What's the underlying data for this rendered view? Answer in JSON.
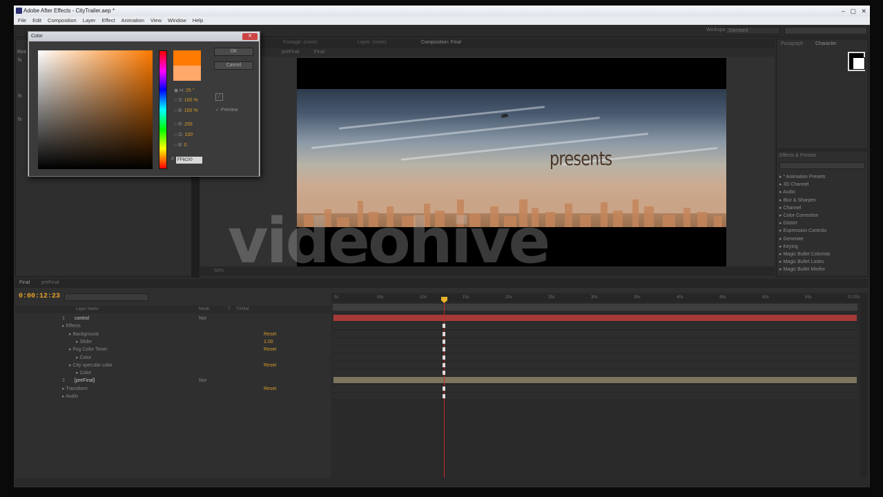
{
  "window": {
    "title": "Adobe After Effects - CityTrailer.aep *",
    "min": "–",
    "max": "▢",
    "close": "✕"
  },
  "menu": [
    "File",
    "Edit",
    "Composition",
    "Layer",
    "Effect",
    "Animation",
    "View",
    "Window",
    "Help"
  ],
  "toolbar": {
    "workspace_label": "Workspace:",
    "workspace_value": "Standard"
  },
  "left_panel": {
    "rows": [
      "fx",
      "fx",
      "fx"
    ],
    "label": "Rea"
  },
  "comp_panel": {
    "tabs": [
      "Footage: (none)",
      "Layer: (none)",
      "Composition: Final"
    ],
    "crumbs": [
      "preFinal",
      "Final"
    ],
    "overlay_text": "presents",
    "watermark": "videohive",
    "zoom": "50%"
  },
  "right_panel": {
    "tabs": [
      "Paragraph",
      "Character"
    ]
  },
  "effects_panel": {
    "title": "Effects & Presets",
    "items": [
      "* Animation Presets",
      "3D Channel",
      "Audio",
      "Blur & Sharpen",
      "Channel",
      "Color Correction",
      "Distort",
      "Expression Controls",
      "Generate",
      "Keying",
      "Magic Bullet Colorista",
      "Magic Bullet Looks",
      "Magic Bullet Misfire"
    ]
  },
  "timeline": {
    "tabs": [
      "Final",
      "preFinal"
    ],
    "timecode": "0:00:12:23",
    "headers": {
      "layer_name": "Layer Name",
      "mode": "Mode",
      "t": "T",
      "trkmat": "TrkMat"
    },
    "ruler": [
      "0s",
      "05s",
      "10s",
      "15s",
      "20s",
      "25s",
      "30s",
      "35s",
      "40s",
      "45s",
      "50s",
      "55s",
      "01:00s"
    ],
    "layers": [
      {
        "indent": 0,
        "num": "1",
        "name": "control",
        "mode": "Nor",
        "value": ""
      },
      {
        "indent": 1,
        "name": "Effects",
        "value": ""
      },
      {
        "indent": 2,
        "name": "Background",
        "value": "Reset"
      },
      {
        "indent": 3,
        "name": "Slider",
        "value": "2.00"
      },
      {
        "indent": 2,
        "name": "Fog Color Toner",
        "value": "Reset"
      },
      {
        "indent": 3,
        "name": "Color",
        "value": ""
      },
      {
        "indent": 2,
        "name": "City specular color",
        "value": "Reset"
      },
      {
        "indent": 3,
        "name": "Color",
        "value": ""
      },
      {
        "indent": 0,
        "num": "2",
        "name": "[preFinal]",
        "mode": "Nor",
        "value": ""
      },
      {
        "indent": 1,
        "name": "Transform",
        "value": "Reset"
      },
      {
        "indent": 1,
        "name": "Audio",
        "value": ""
      }
    ]
  },
  "color_dialog": {
    "title": "Color",
    "ok": "OK",
    "cancel": "Cancel",
    "preview": "Preview",
    "hsb": {
      "h": "25 °",
      "s": "100 %",
      "b": "100 %"
    },
    "rgb": {
      "r": "255",
      "g": "100",
      "b": "0"
    },
    "hex": "FF6C00",
    "current_color": "#ff7a00",
    "original_color": "#ffa86a"
  }
}
